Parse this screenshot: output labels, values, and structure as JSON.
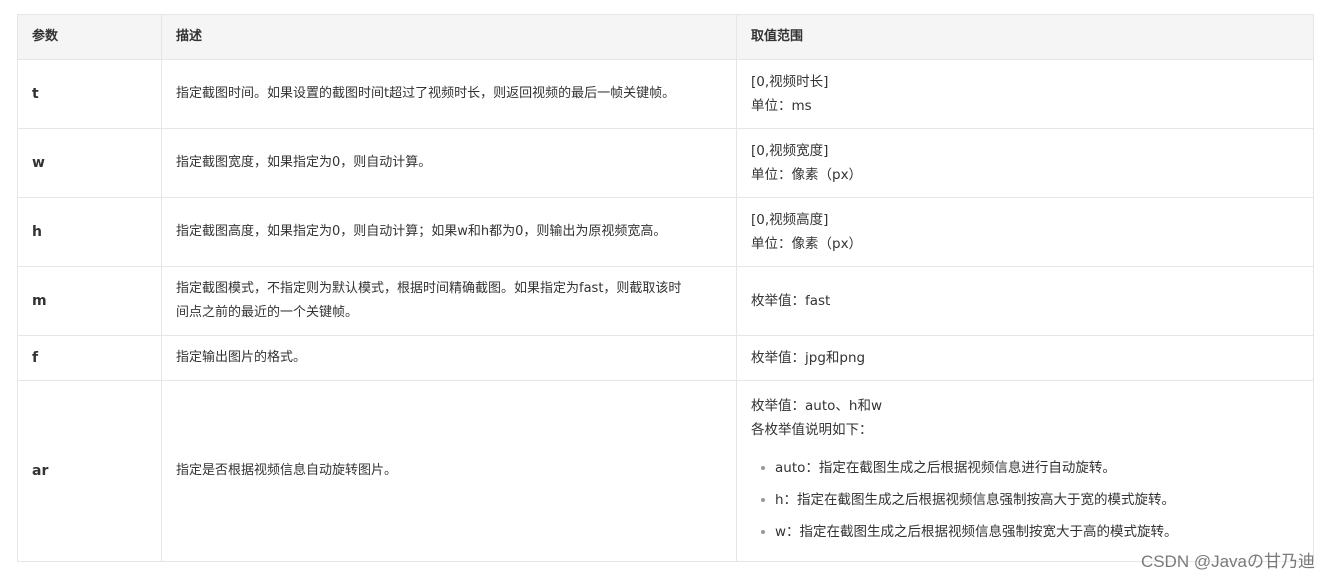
{
  "table": {
    "headers": [
      "参数",
      "描述",
      "取值范围"
    ],
    "rows": [
      {
        "param": "t",
        "desc": "指定截图时间。如果设置的截图时间t超过了视频时长，则返回视频的最后一帧关键帧。",
        "range": [
          "[0,视频时长]",
          "单位：ms"
        ]
      },
      {
        "param": "w",
        "desc": "指定截图宽度，如果指定为0，则自动计算。",
        "range": [
          "[0,视频宽度]",
          "单位：像素（px）"
        ]
      },
      {
        "param": "h",
        "desc": "指定截图高度，如果指定为0，则自动计算；如果w和h都为0，则输出为原视频宽高。",
        "range": [
          "[0,视频高度]",
          "单位：像素（px）"
        ]
      },
      {
        "param": "m",
        "desc": [
          "指定截图模式，不指定则为默认模式，根据时间精确截图。如果指定为fast，则截取该时",
          "间点之前的最近的一个关键帧。"
        ],
        "range": [
          "枚举值：fast"
        ]
      },
      {
        "param": "f",
        "desc": "指定输出图片的格式。",
        "range": [
          "枚举值：jpg和png"
        ]
      },
      {
        "param": "ar",
        "desc": "指定是否根据视频信息自动旋转图片。",
        "range": [
          "枚举值：auto、h和w",
          "各枚举值说明如下："
        ],
        "range_list": [
          "auto：指定在截图生成之后根据视频信息进行自动旋转。",
          "h：指定在截图生成之后根据视频信息强制按高大于宽的模式旋转。",
          "w：指定在截图生成之后根据视频信息强制按宽大于高的模式旋转。"
        ]
      }
    ]
  },
  "watermark": "CSDN @Javaの甘乃迪"
}
